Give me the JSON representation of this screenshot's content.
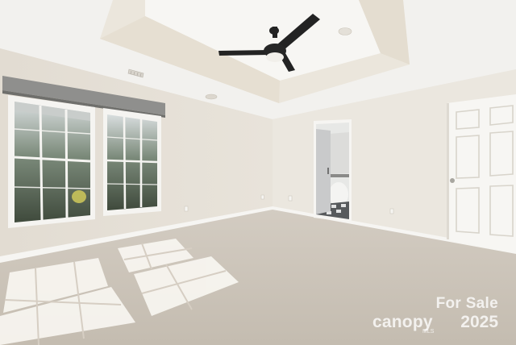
{
  "watermark": {
    "line1": "For Sale",
    "brand": "canopy",
    "sub": "MLS",
    "year": "2025"
  },
  "colors": {
    "ceiling": "#f4f3f1",
    "wall_left": "#e3ddd3",
    "wall_back": "#ebe7df",
    "carpet": "#cfc7bc",
    "trim": "#f7f6f3",
    "fan": "#232323",
    "sunlight": "#fbf9f4"
  },
  "icons": [
    "ceiling-fan-icon",
    "recessed-light-icon",
    "air-vent-icon",
    "electrical-outlet-icon",
    "door-knob-icon"
  ]
}
